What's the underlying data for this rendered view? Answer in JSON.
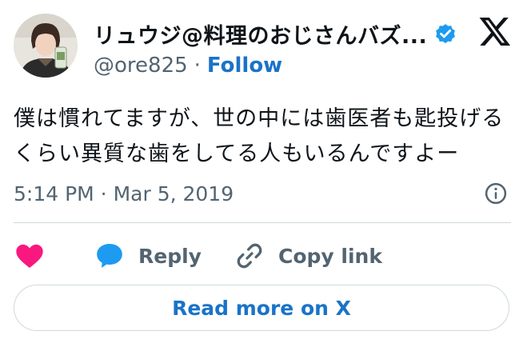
{
  "author": {
    "display_name": "リュウジ@料理のおじさんバズ...",
    "handle": "@ore825",
    "separator": "·",
    "follow_label": "Follow"
  },
  "tweet": {
    "lines": [
      "僕は慣れてますが、世の中には歯医者も匙投げる",
      "くらい異質な歯をしてる人もいるんですよー"
    ],
    "timestamp": "5:14 PM · Mar 5, 2019"
  },
  "actions": {
    "reply_label": "Reply",
    "copy_link_label": "Copy link"
  },
  "read_more_label": "Read more on X",
  "colors": {
    "like": "#f91880",
    "reply": "#1d9bf0",
    "link": "#1a73c8",
    "verified": "#1d9bf0",
    "muted": "#536471"
  },
  "icons": {
    "like": "heart-icon",
    "reply": "speech-bubble-icon",
    "copy_link": "link-icon",
    "info": "info-icon",
    "logo": "x-logo-icon",
    "verified": "verified-badge-icon"
  }
}
